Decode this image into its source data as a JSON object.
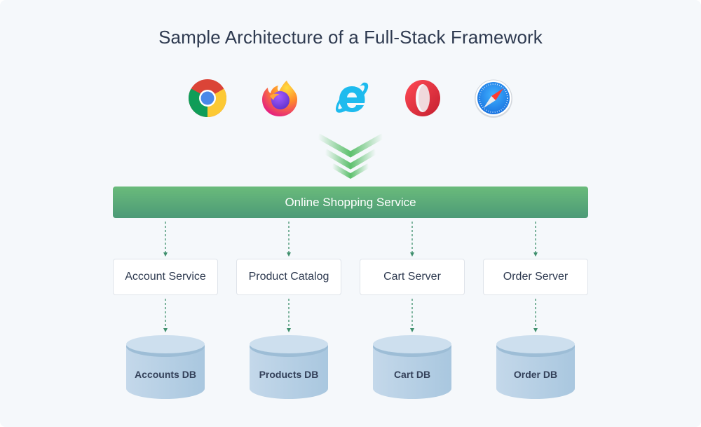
{
  "title": "Sample Architecture of a Full-Stack Framework",
  "browsers": [
    {
      "name": "Chrome",
      "icon": "chrome-icon"
    },
    {
      "name": "Firefox",
      "icon": "firefox-icon"
    },
    {
      "name": "Internet Explorer",
      "icon": "internet-explorer-icon"
    },
    {
      "name": "Opera",
      "icon": "opera-icon"
    },
    {
      "name": "Safari",
      "icon": "safari-icon"
    }
  ],
  "gateway": {
    "label": "Online Shopping Service"
  },
  "services": [
    {
      "label": "Account Service",
      "database": "Accounts DB"
    },
    {
      "label": "Product Catalog",
      "database": "Products DB"
    },
    {
      "label": "Cart Server",
      "database": "Cart DB"
    },
    {
      "label": "Order Server",
      "database": "Order DB"
    }
  ],
  "colors": {
    "gateway_top": "#6abb7b",
    "gateway_bottom": "#4c9a77",
    "connector": "#3f8f6d",
    "database": "#b3cde2",
    "title_text": "#2e3a50",
    "background": "#f5f8fb"
  }
}
